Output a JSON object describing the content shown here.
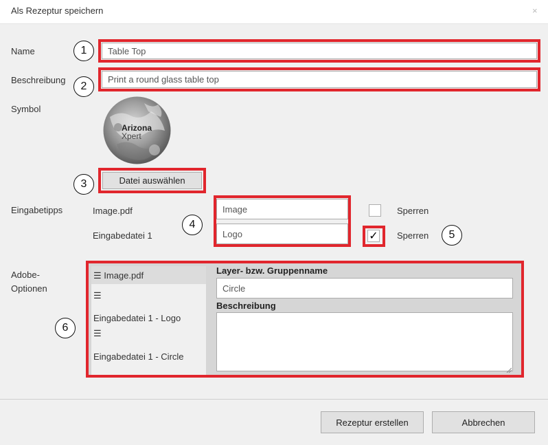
{
  "window": {
    "title": "Als Rezeptur speichern",
    "close_glyph": "×"
  },
  "form": {
    "name_label": "Name",
    "name_value": "Table Top",
    "description_label": "Beschreibung",
    "description_value": "Print a round glass table top",
    "symbol_label": "Symbol",
    "symbol_logo_line1": "Arizona",
    "symbol_logo_line2": "Xpert",
    "select_file_button": "Datei auswählen",
    "hints_label": "Eingabetipps",
    "hints": [
      {
        "file": "Image.pdf",
        "value": "Image",
        "lock_label": "Sperren",
        "locked": false
      },
      {
        "file": "Eingabedatei 1",
        "value": "Logo",
        "lock_label": "Sperren",
        "locked": true
      }
    ],
    "checkmark": "✓",
    "adobe_label_line1": "Adobe-",
    "adobe_label_line2": "Optionen",
    "adobe_list": [
      {
        "label": "☰ Image.pdf",
        "selected": true
      },
      {
        "label": "☰",
        "selected": false
      },
      {
        "label": "Eingabedatei 1 - Logo",
        "selected": false
      },
      {
        "label": "☰",
        "selected": false
      },
      {
        "label": "Eingabedatei 1 - Circle",
        "selected": false
      }
    ],
    "layer_name_label": "Layer- bzw. Gruppenname",
    "layer_name_value": "Circle",
    "layer_desc_label": "Beschreibung",
    "layer_desc_value": ""
  },
  "callouts": [
    "1",
    "2",
    "3",
    "4",
    "5",
    "6"
  ],
  "footer": {
    "create_button": "Rezeptur erstellen",
    "cancel_button": "Abbrechen"
  },
  "colors": {
    "highlight": "#e1262d",
    "dialog_bg": "#f0f0f0",
    "selected_item": "#dcdcdc"
  }
}
